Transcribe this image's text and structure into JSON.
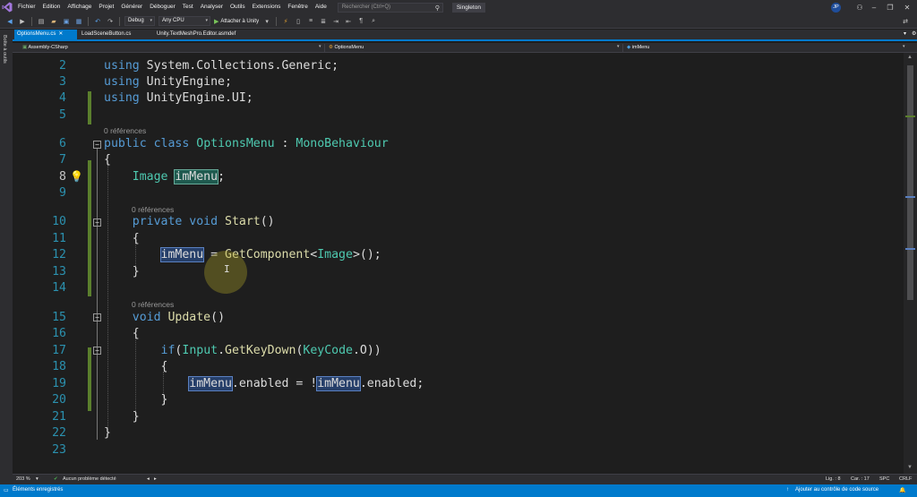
{
  "menu": {
    "items": [
      "Fichier",
      "Edition",
      "Affichage",
      "Projet",
      "Générer",
      "Déboguer",
      "Test",
      "Analyser",
      "Outils",
      "Extensions",
      "Fenêtre",
      "Aide"
    ],
    "search_placeholder": "Rechercher (Ctrl+Q)",
    "solution_name": "Singleton",
    "account_initials": "JP"
  },
  "toolbar": {
    "configuration": "Debug",
    "platform": "Any CPU",
    "run_label": "Attacher à Unity"
  },
  "left_dock": {
    "toolbox_label": "Boîte à outils"
  },
  "tabs": [
    {
      "label": "OptionsMenu.cs",
      "active": true
    },
    {
      "label": "LoadSceneButton.cs",
      "active": false
    },
    {
      "label": "Unity.TextMeshPro.Editor.asmdef",
      "active": false
    }
  ],
  "navbar": {
    "project": "Assembly-CSharp",
    "type": "OptionsMenu",
    "member": "imMenu"
  },
  "editor": {
    "lens_text": "0 références",
    "lines": [
      {
        "num": "2",
        "text": "using System.Collections.Generic;"
      },
      {
        "num": "3",
        "text": "using UnityEngine;"
      },
      {
        "num": "4",
        "text": "using UnityEngine.UI;"
      },
      {
        "num": "5",
        "text": ""
      },
      {
        "num": "6",
        "text": "public class OptionsMenu : MonoBehaviour"
      },
      {
        "num": "7",
        "text": "{"
      },
      {
        "num": "8",
        "text": "    Image imMenu;"
      },
      {
        "num": "9",
        "text": ""
      },
      {
        "num": "10",
        "text": "    private void Start()"
      },
      {
        "num": "11",
        "text": "    {"
      },
      {
        "num": "12",
        "text": "        imMenu = GetComponent<Image>();"
      },
      {
        "num": "13",
        "text": "    }"
      },
      {
        "num": "14",
        "text": ""
      },
      {
        "num": "15",
        "text": "    void Update()"
      },
      {
        "num": "16",
        "text": "    {"
      },
      {
        "num": "17",
        "text": "        if(Input.GetKeyDown(KeyCode.O))"
      },
      {
        "num": "18",
        "text": "        {"
      },
      {
        "num": "19",
        "text": "            imMenu.enabled = !imMenu.enabled;"
      },
      {
        "num": "20",
        "text": "        }"
      },
      {
        "num": "21",
        "text": "    }"
      },
      {
        "num": "22",
        "text": "}"
      },
      {
        "num": "23",
        "text": ""
      }
    ]
  },
  "editor_status": {
    "zoom": "203 %",
    "issues": "Aucun problème détecté",
    "line": "Lig. : 8",
    "col": "Car. : 17",
    "whitespace": "SPC",
    "line_ending": "CRLF"
  },
  "statusbar": {
    "message": "Éléments enregistrés",
    "source_control": "Ajouter au contrôle de code source"
  },
  "colors": {
    "accent": "#007acc",
    "keyword": "#569cd6",
    "type": "#4ec9b0",
    "method": "#dcdcaa",
    "line_number": "#2b91af",
    "change_marker": "#5b7f2d"
  }
}
